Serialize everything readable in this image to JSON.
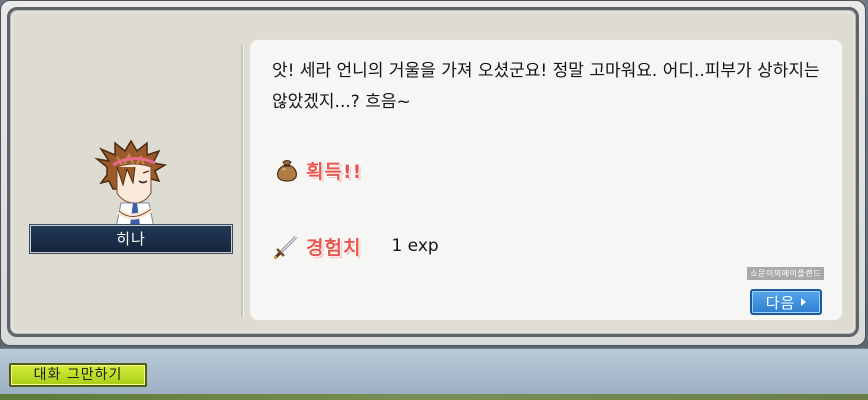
{
  "dialog": {
    "text": "앗! 세라 언니의 거울을 가져 오셨군요! 정말 고마워요. 어디..피부가 상하지는 않았겠지...? 흐음~",
    "speaker_name": "히나",
    "speaker_sprite_icon": "npc-hina-sprite"
  },
  "rewards": {
    "obtain": {
      "icon": "money-bag-icon",
      "label": "획득!!"
    },
    "exp": {
      "icon": "sword-icon",
      "label": "경험치",
      "value": "1 exp"
    }
  },
  "watermark": "소문이의메이플랜드",
  "buttons": {
    "next_label": "다음",
    "end_chat_label": "대화 그만하기"
  },
  "colors": {
    "reward_label": "#e8574f",
    "next_button": "#3f93e0",
    "end_chat_button": "#c2df2a",
    "name_plate": "#1b2f4a"
  }
}
